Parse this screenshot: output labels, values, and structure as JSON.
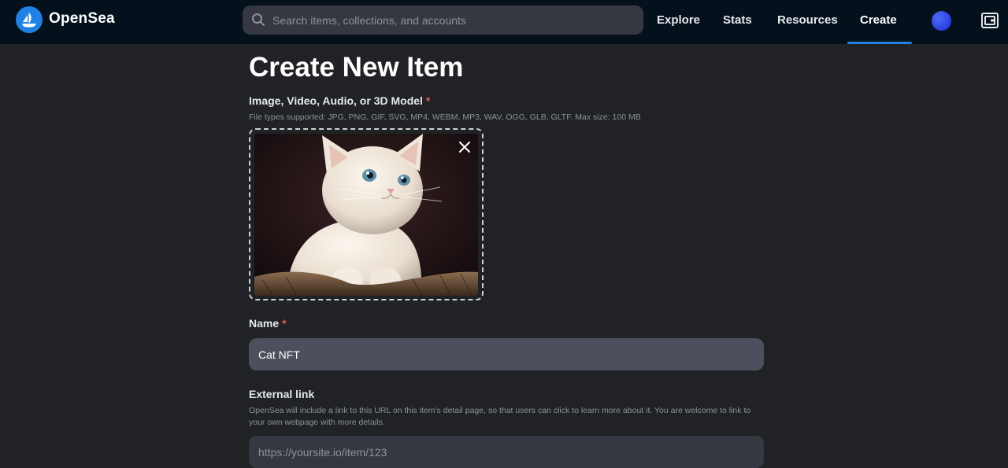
{
  "nav": {
    "brand": "OpenSea",
    "search_placeholder": "Search items, collections, and accounts",
    "links": {
      "explore": "Explore",
      "stats": "Stats",
      "resources": "Resources",
      "create": "Create"
    },
    "active_link": "Create",
    "accent_color": "#2081e2"
  },
  "form": {
    "title": "Create New Item",
    "media": {
      "label": "Image, Video, Audio, or 3D Model",
      "required_mark": "*",
      "hint": "File types supported: JPG, PNG, GIF, SVG, MP4, WEBM, MP3, WAV, OGG, GLB, GLTF. Max size: 100 MB",
      "preview": "cat-image"
    },
    "name": {
      "label": "Name",
      "required_mark": "*",
      "value": "Cat NFT"
    },
    "external_link": {
      "label": "External link",
      "hint": "OpenSea will include a link to this URL on this item's detail page, so that users can click to learn more about it. You are welcome to link to your own webpage with more details.",
      "placeholder": "https://yoursite.io/item/123",
      "value": ""
    }
  },
  "icons": {
    "logo": "opensea-logo-icon",
    "search": "search-icon",
    "avatar": "avatar",
    "wallet": "wallet-icon",
    "close": "close-icon"
  }
}
